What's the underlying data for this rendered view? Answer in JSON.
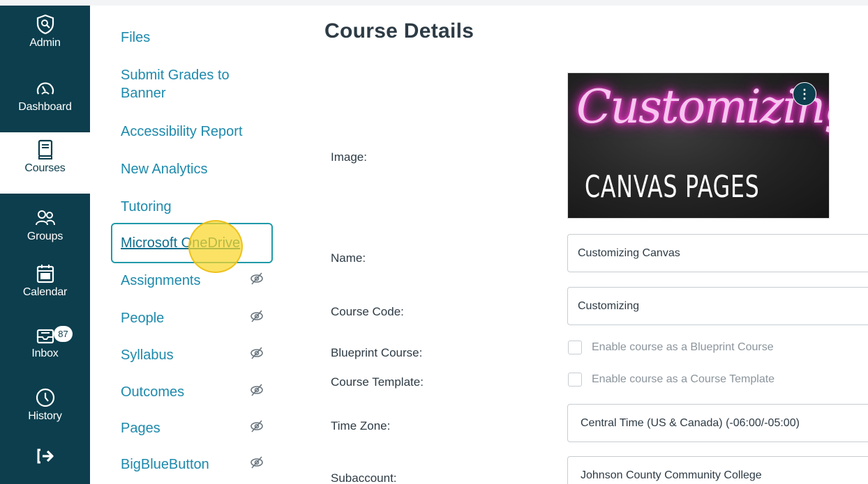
{
  "global_nav": {
    "items": [
      {
        "label": "Admin",
        "icon": "admin-shield-icon"
      },
      {
        "label": "Dashboard",
        "icon": "dashboard-gauge-icon"
      },
      {
        "label": "Courses",
        "icon": "courses-book-icon",
        "active": true
      },
      {
        "label": "Groups",
        "icon": "groups-people-icon"
      },
      {
        "label": "Calendar",
        "icon": "calendar-icon"
      },
      {
        "label": "Inbox",
        "icon": "inbox-icon",
        "badge": "87"
      },
      {
        "label": "History",
        "icon": "history-clock-icon"
      },
      {
        "label": "",
        "icon": "logout-arrow-icon"
      }
    ]
  },
  "course_nav": {
    "items": [
      {
        "label": "Files"
      },
      {
        "label": "Submit Grades to\nBanner"
      },
      {
        "label": "Accessibility Report"
      },
      {
        "label": "New Analytics"
      },
      {
        "label": "Tutoring"
      },
      {
        "label": "Microsoft OneDrive",
        "focused": true
      },
      {
        "label": "Assignments",
        "hidden": true
      },
      {
        "label": "People",
        "hidden": true
      },
      {
        "label": "Syllabus",
        "hidden": true
      },
      {
        "label": "Outcomes",
        "hidden": true
      },
      {
        "label": "Pages",
        "hidden": true
      },
      {
        "label": "BigBlueButton",
        "hidden": true
      }
    ]
  },
  "main": {
    "title": "Course Details",
    "image": {
      "label": "Image:",
      "script_text": "Customizing",
      "caps_text": "CANVAS PAGES",
      "menu_icon": "kebab-menu-icon"
    },
    "name": {
      "label": "Name:",
      "value": "Customizing Canvas"
    },
    "course_code": {
      "label": "Course Code:",
      "value": "Customizing"
    },
    "blueprint": {
      "label": "Blueprint Course:",
      "checkbox_label": "Enable course as a Blueprint Course"
    },
    "template": {
      "label": "Course Template:",
      "checkbox_label": "Enable course as a Course Template"
    },
    "time_zone": {
      "label": "Time Zone:",
      "value": "Central Time (US & Canada) (-06:00/-05:00)"
    },
    "subaccount": {
      "label": "Subaccount:",
      "value": "Johnson County Community College"
    }
  },
  "colors": {
    "nav_bg": "#0c3e4d",
    "link": "#0e7fa1",
    "text": "#2d3b45",
    "highlight": "#fad728"
  }
}
